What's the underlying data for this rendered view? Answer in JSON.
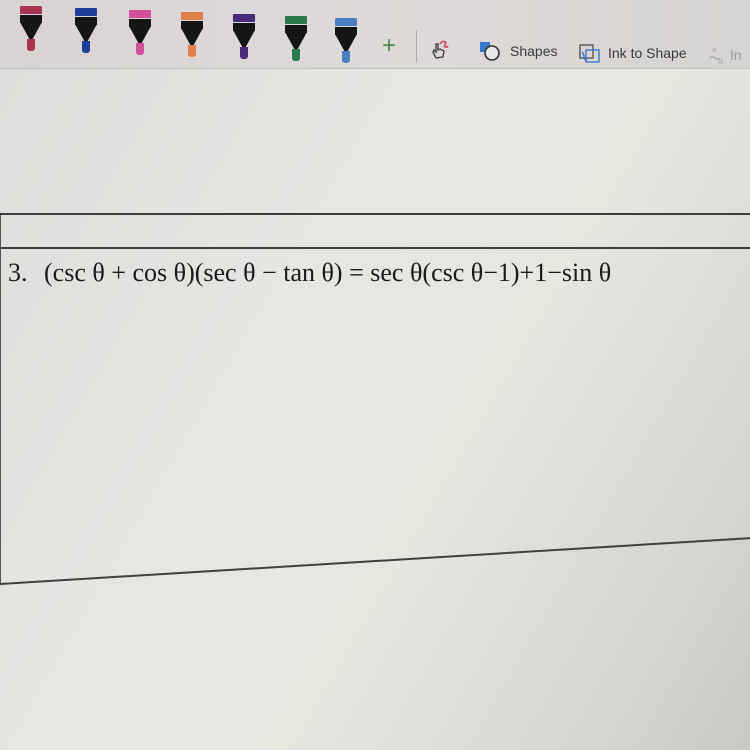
{
  "toolbar": {
    "pens": [
      {
        "name": "pen-maroon",
        "color": "#a8324f"
      },
      {
        "name": "pen-blue",
        "color": "#1e3f9a"
      },
      {
        "name": "pen-pink",
        "color": "#d0509a"
      },
      {
        "name": "pen-orange",
        "color": "#e0804a"
      },
      {
        "name": "pen-purple",
        "color": "#4a2a7a"
      },
      {
        "name": "pen-green",
        "color": "#2a7a4a"
      },
      {
        "name": "pen-light-blue",
        "color": "#4a80c0"
      }
    ],
    "add_pen_label": "+",
    "shapes_label": "Shapes",
    "ink_to_shape_label": "Ink to Shape",
    "ink_to_text_label": "In"
  },
  "content": {
    "problem_number": "3.",
    "equation": "(csc θ + cos θ)(sec θ − tan θ) = sec θ(csc θ−1)+1−sin θ"
  }
}
